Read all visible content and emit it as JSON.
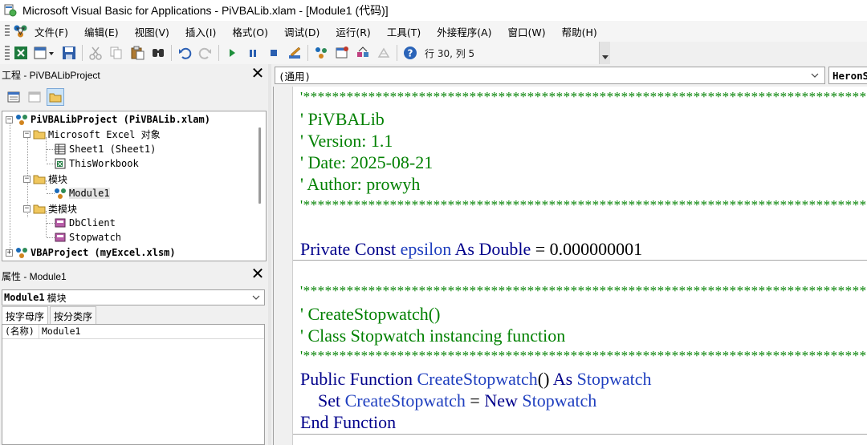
{
  "window": {
    "title": "Microsoft Visual Basic for Applications - PiVBALib.xlam - [Module1 (代码)]"
  },
  "menu": {
    "items": [
      "文件(F)",
      "编辑(E)",
      "视图(V)",
      "插入(I)",
      "格式(O)",
      "调试(D)",
      "运行(R)",
      "工具(T)",
      "外接程序(A)",
      "窗口(W)",
      "帮助(H)"
    ]
  },
  "toolbar": {
    "position_label": "行 30, 列 5"
  },
  "project_panel": {
    "title": "工程 - PiVBALibProject",
    "close_glyph": "✕",
    "tree": [
      {
        "label": "PiVBALibProject (PiVBALib.xlam)",
        "level": 0,
        "bold": true,
        "expander": "−"
      },
      {
        "label": "Microsoft Excel 对象",
        "level": 1,
        "expander": "−"
      },
      {
        "label": "Sheet1 (Sheet1)",
        "level": 2
      },
      {
        "label": "ThisWorkbook",
        "level": 2
      },
      {
        "label": "模块",
        "level": 1,
        "expander": "−"
      },
      {
        "label": "Module1",
        "level": 2,
        "selected": true
      },
      {
        "label": "类模块",
        "level": 1,
        "expander": "−"
      },
      {
        "label": "DbClient",
        "level": 2
      },
      {
        "label": "Stopwatch",
        "level": 2
      },
      {
        "label": "VBAProject (myExcel.xlsm)",
        "level": 0,
        "bold": true,
        "expander": "+"
      }
    ]
  },
  "properties_panel": {
    "title": "属性 - Module1",
    "close_glyph": "✕",
    "object_name": "Module1",
    "object_type": "模块",
    "tabs": [
      "按字母序",
      "按分类序"
    ],
    "rows": [
      {
        "name": "(名称)",
        "value": "Module1"
      }
    ]
  },
  "code_window": {
    "object_combo": "(通用)",
    "proc_combo": "HeronS",
    "stars": "'**********************************************************************************"
  },
  "colors": {
    "comment": "#008000",
    "keyword": "#00008b",
    "identifier": "#1f3fbf"
  }
}
